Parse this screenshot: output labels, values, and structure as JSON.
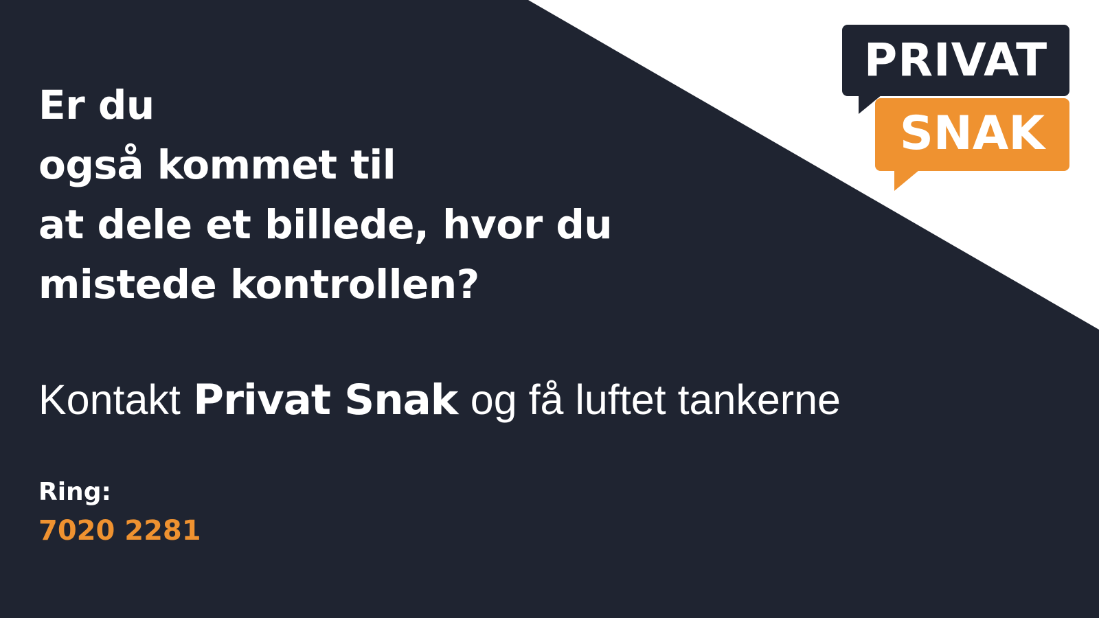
{
  "headline": {
    "lines": [
      "Er du",
      "også kommet til",
      "at dele et billede, hvor du",
      "mistede kontrollen?"
    ]
  },
  "tagline": {
    "before": "Kontakt",
    "brand": "Privat Snak",
    "after": "og få luftet tankerne"
  },
  "contact": {
    "label": "Ring:",
    "phone": "7020 2281"
  },
  "logo": {
    "top_text": "PRIVAT",
    "bottom_text": "SNAK"
  },
  "colors": {
    "background": "#1f2431",
    "accent": "#ef9230",
    "corner": "#ffffff"
  }
}
